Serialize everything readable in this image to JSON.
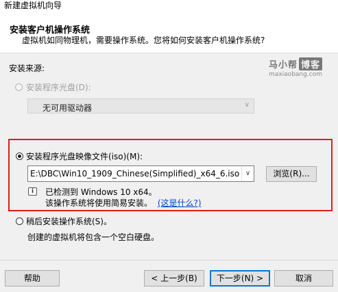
{
  "window": {
    "title": "新建虚拟机向导"
  },
  "header": {
    "title": "安装客户机操作系统",
    "subtitle": "虚拟机如同物理机，需要操作系统。您将如何安装客户机操作系统?"
  },
  "watermark": {
    "brand": "马小帮",
    "boxed": "博客",
    "url": "maxiaobang.com"
  },
  "install_source": {
    "label": "安装来源:",
    "options": {
      "disc": {
        "label": "安装程序光盘(D):",
        "selected": false,
        "enabled": false,
        "dropdown_value": "无可用驱动器"
      },
      "iso": {
        "label": "安装程序光盘映像文件(iso)(M):",
        "selected": true,
        "path_value": "E:\\DBC\\Win10_1909_Chinese(Simplified)_x64_6.iso",
        "browse_label": "浏览(R)...",
        "detected": "已检测到 Windows 10 x64。",
        "easy_install": "该操作系统将使用简易安装。",
        "link": "(这是什么?)"
      },
      "later": {
        "label": "稍后安装操作系统(S)。",
        "selected": false,
        "note": "创建的虚拟机将包含一个空白硬盘。"
      }
    }
  },
  "footer": {
    "help": "帮助",
    "back": "< 上一步(B)",
    "next": "下一步(N) >",
    "cancel": "取消"
  },
  "colors": {
    "highlight_box": "#e21b1b",
    "link": "#0044cc",
    "focus": "#0078d7"
  }
}
